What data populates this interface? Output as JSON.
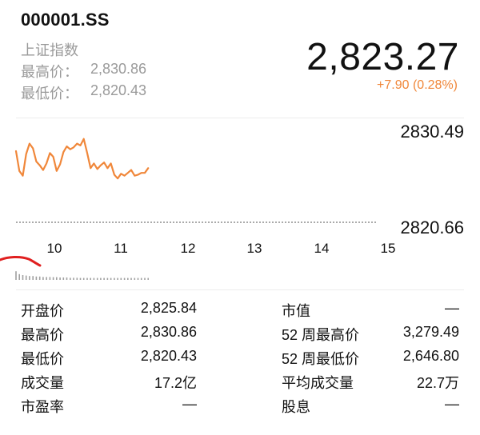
{
  "quote": {
    "ticker": "000001.SS",
    "name": "上证指数",
    "high_label": "最高价：",
    "high_value": "2,830.86",
    "low_label": "最低价：",
    "low_value": "2,820.43",
    "price": "2,823.27",
    "change": "+7.90 (0.28%)"
  },
  "chart": {
    "axis_top": "2830.49",
    "axis_bottom": "2820.66",
    "x_ticks": [
      "10",
      "11",
      "12",
      "13",
      "14",
      "15"
    ]
  },
  "chart_data": {
    "type": "line",
    "ylim": [
      2820.66,
      2830.49
    ],
    "xlim": [
      9.5,
      15
    ],
    "series": [
      {
        "color": "#f0873a",
        "x": [
          9.5,
          9.55,
          9.6,
          9.65,
          9.7,
          9.75,
          9.8,
          9.85,
          9.9,
          9.95,
          10.0,
          10.05,
          10.1,
          10.15,
          10.2,
          10.25,
          10.3,
          10.35,
          10.4,
          10.45,
          10.5,
          10.55,
          10.6,
          10.65,
          10.7,
          10.75,
          10.8,
          10.85,
          10.9,
          10.95,
          11.0,
          11.05,
          11.1,
          11.15,
          11.2,
          11.25,
          11.3,
          11.35,
          11.4,
          11.45
        ],
        "values": [
          2828.2,
          2826.1,
          2825.6,
          2827.9,
          2829.0,
          2828.5,
          2827.1,
          2826.7,
          2826.2,
          2826.9,
          2828.0,
          2827.6,
          2826.1,
          2826.8,
          2828.1,
          2828.7,
          2828.4,
          2828.6,
          2829.0,
          2828.8,
          2829.5,
          2828.0,
          2826.4,
          2826.9,
          2826.3,
          2826.7,
          2827.0,
          2826.4,
          2826.9,
          2825.7,
          2825.3,
          2825.8,
          2825.6,
          2825.9,
          2826.2,
          2825.6,
          2825.7,
          2825.9,
          2825.9,
          2826.4
        ]
      }
    ],
    "volume": [
      0.9,
      0.6,
      0.5,
      0.45,
      0.4,
      0.4,
      0.35,
      0.35,
      0.3,
      0.3,
      0.3,
      0.28,
      0.28,
      0.25,
      0.25,
      0.25,
      0.22,
      0.22,
      0.22,
      0.2,
      0.2,
      0.2,
      0.2,
      0.2,
      0.2,
      0.2,
      0.2,
      0.2,
      0.2,
      0.2,
      0.2,
      0.2,
      0.2,
      0.2,
      0.2,
      0.2,
      0.2,
      0.2,
      0.2,
      0.2
    ],
    "grid": false,
    "legend": "none",
    "colors": {
      "line": "#f0873a",
      "marker": "#e02020",
      "volume": "#a0a0a0"
    }
  },
  "stats_left": [
    {
      "label": "开盘价",
      "value": "2,825.84"
    },
    {
      "label": "最高价",
      "value": "2,830.86"
    },
    {
      "label": "最低价",
      "value": "2,820.43"
    },
    {
      "label": "成交量",
      "value": "17.2亿"
    },
    {
      "label": "市盈率",
      "value": "—"
    }
  ],
  "stats_right": [
    {
      "label": "市值",
      "value": "—"
    },
    {
      "label": "52 周最高价",
      "value": "3,279.49"
    },
    {
      "label": "52 周最低价",
      "value": "2,646.80"
    },
    {
      "label": "平均成交量",
      "value": "22.7万"
    },
    {
      "label": "股息",
      "value": "—"
    }
  ]
}
